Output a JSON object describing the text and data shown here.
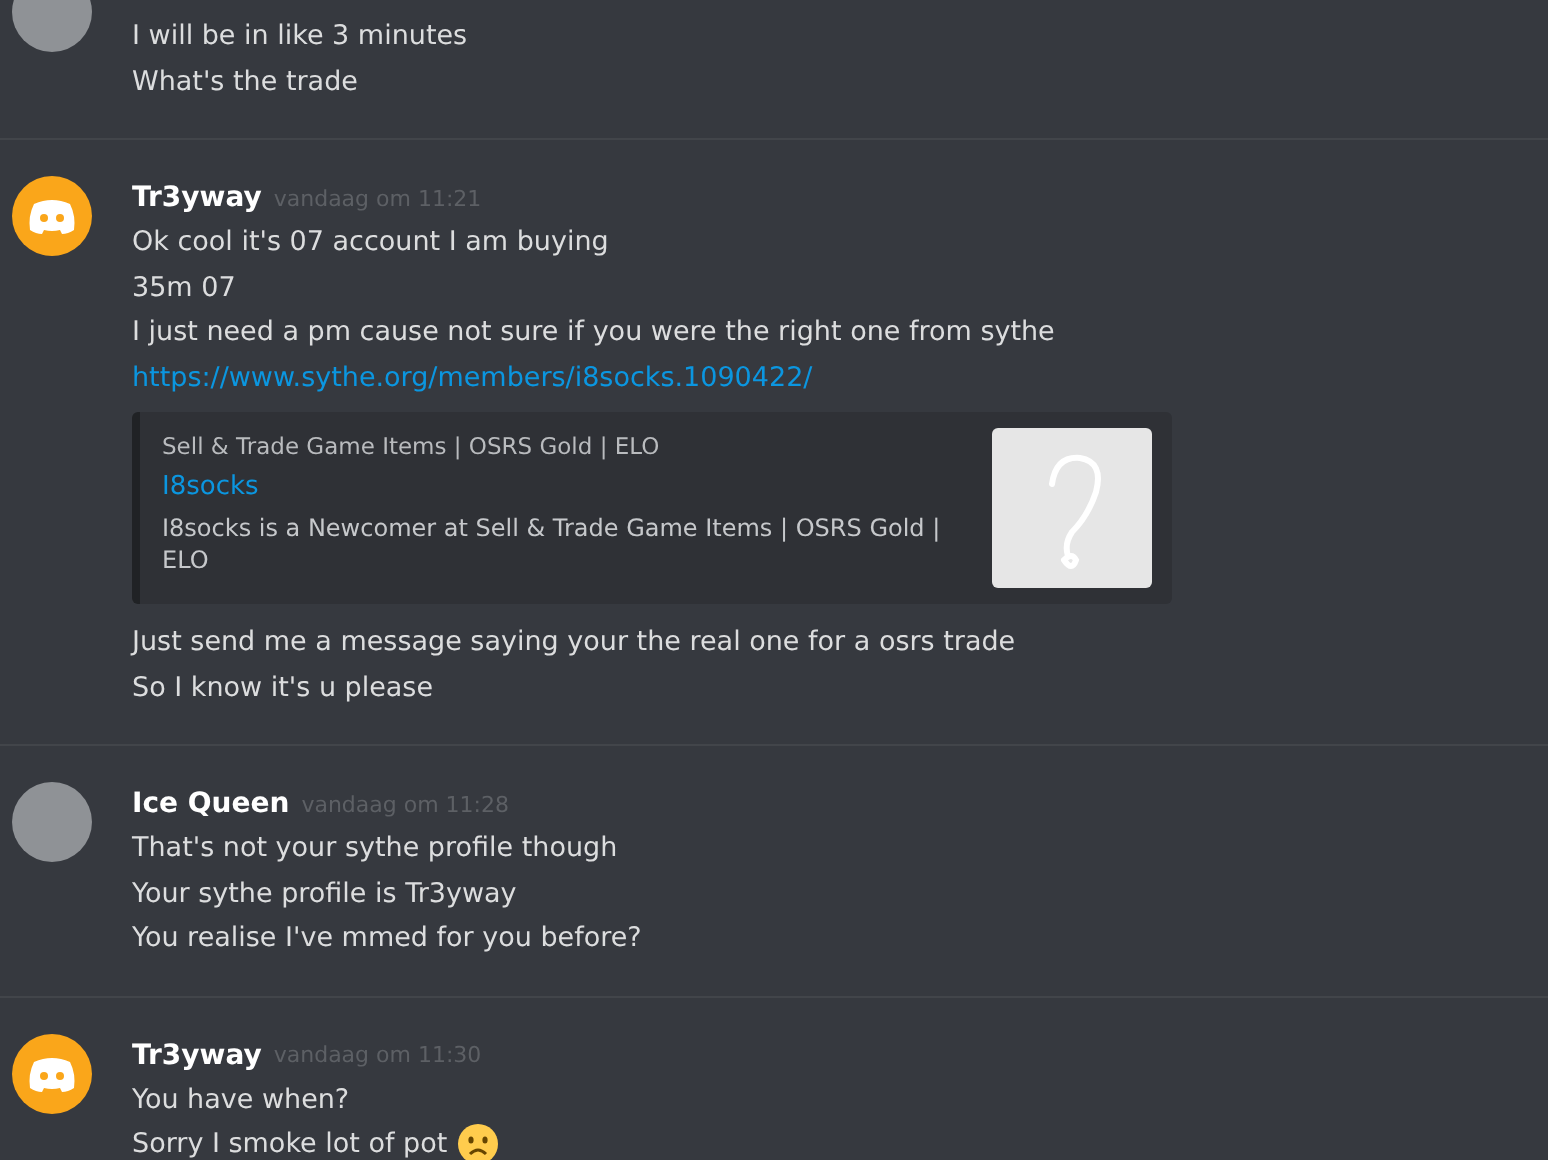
{
  "messages": [
    {
      "avatar": {
        "kind": "photo"
      },
      "lines": [
        {
          "kind": "text",
          "text": "I will be in like 3 minutes"
        },
        {
          "kind": "text",
          "text": "What's the trade"
        }
      ]
    },
    {
      "author": "Tr3yway",
      "time": "vandaag om 11:21",
      "avatar": {
        "kind": "logo"
      },
      "lines": [
        {
          "kind": "text",
          "text": "Ok cool it's 07 account I am buying"
        },
        {
          "kind": "text",
          "text": "35m 07"
        },
        {
          "kind": "text",
          "text": "I just need a pm cause not sure if you were the right one from sythe"
        },
        {
          "kind": "link",
          "text": "https://www.sythe.org/members/i8socks.1090422/"
        },
        {
          "kind": "embed",
          "provider": "Sell & Trade Game Items | OSRS Gold | ELO",
          "title": "I8socks",
          "description": "I8socks is a Newcomer at Sell & Trade Game Items | OSRS Gold | ELO"
        },
        {
          "kind": "text",
          "text": "Just send me a message saying your the real one for a osrs trade"
        },
        {
          "kind": "text",
          "text": "So I know it's u please"
        }
      ]
    },
    {
      "author": "Ice Queen",
      "time": "vandaag om 11:28",
      "avatar": {
        "kind": "photo"
      },
      "lines": [
        {
          "kind": "text",
          "text": "That's not your sythe profile though"
        },
        {
          "kind": "text",
          "text": "Your sythe profile is Tr3yway"
        },
        {
          "kind": "text",
          "text": "You realise I've mmed for you before?"
        }
      ]
    },
    {
      "author": "Tr3yway",
      "time": "vandaag om 11:30",
      "avatar": {
        "kind": "logo"
      },
      "lines": [
        {
          "kind": "text",
          "text": "You have when?"
        },
        {
          "kind": "emoji",
          "text": "Sorry I smoke lot of pot"
        }
      ]
    }
  ]
}
